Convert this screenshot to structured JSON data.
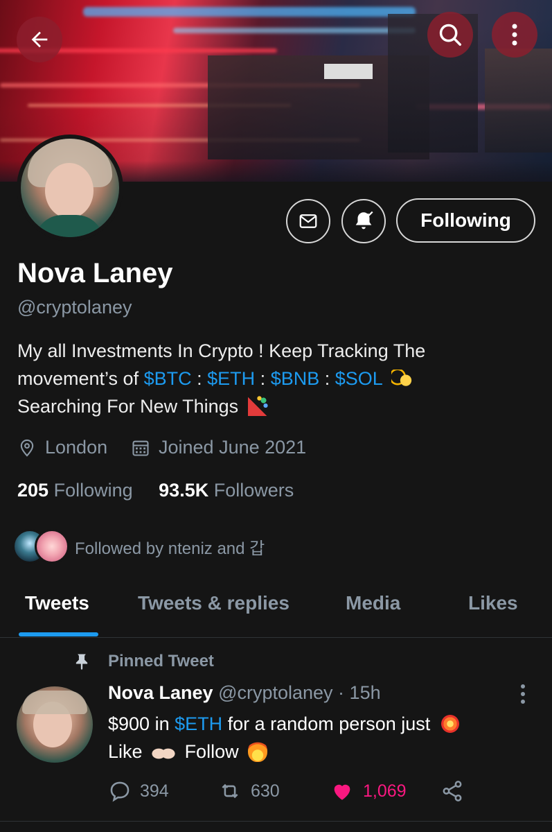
{
  "profile": {
    "name": "Nova Laney",
    "handle": "@cryptolaney",
    "bio_line1": "My all Investments In Crypto ! Keep Tracking The",
    "bio_line2_prefix": "movement’s of ",
    "tickers": [
      "$BTC",
      "$ETH",
      "$BNB",
      "$SOL"
    ],
    "ticker_sep": " : ",
    "bio_line3": "Searching For New Things",
    "location": "London",
    "joined": "Joined June 2021",
    "following_count": "205",
    "following_label": "Following",
    "followers_count": "93.5K",
    "followers_label": "Followers",
    "followed_by": "Followed by nteniz and 갑"
  },
  "actions": {
    "follow_button": "Following"
  },
  "tabs": [
    {
      "label": "Tweets",
      "active": true
    },
    {
      "label": "Tweets & replies",
      "active": false
    },
    {
      "label": "Media",
      "active": false
    },
    {
      "label": "Likes",
      "active": false
    }
  ],
  "tweet": {
    "pinned_label": "Pinned Tweet",
    "author": "Nova Laney",
    "handle_time": "@cryptolaney · 15h",
    "body_part1": "$900 in ",
    "body_link": "$ETH",
    "body_part2": " for a random person just",
    "body_like": "Like",
    "body_follow": "Follow",
    "replies": "394",
    "retweets": "630",
    "likes": "1,069"
  },
  "colors": {
    "accent": "#1d9bf0",
    "like": "#f91880",
    "background": "#151515",
    "muted": "#8b98a5"
  },
  "icons": [
    "back-arrow-icon",
    "search-icon",
    "more-vertical-icon",
    "mail-icon",
    "bell-icon",
    "location-pin-icon",
    "calendar-icon",
    "pin-icon",
    "reply-icon",
    "retweet-icon",
    "heart-icon",
    "share-icon"
  ]
}
